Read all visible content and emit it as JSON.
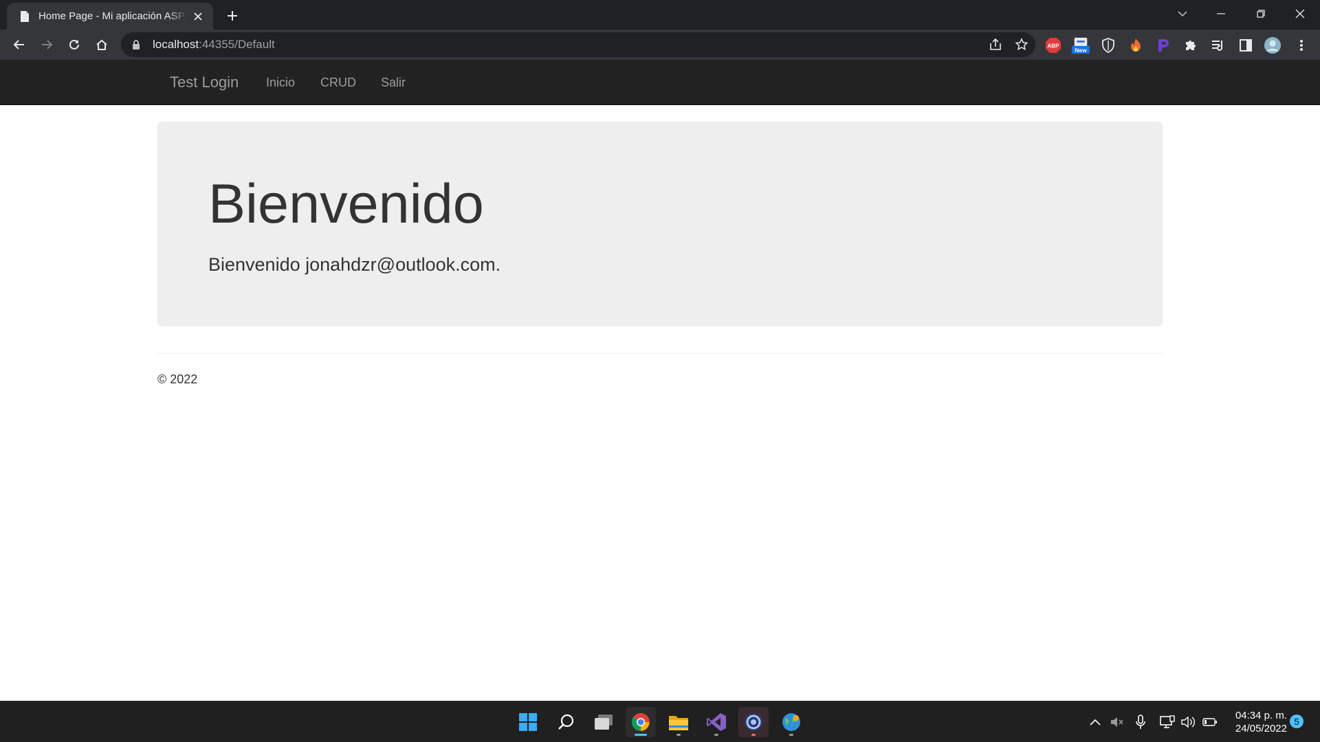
{
  "browser": {
    "tab_title": "Home Page - Mi aplicación ASP.NET",
    "url_host": "localhost",
    "url_rest": ":44355/Default",
    "extensions": [
      {
        "name": "adblock-plus-icon",
        "label": "ABP",
        "color": "#e5383b"
      },
      {
        "name": "new-extension-icon",
        "label": "New",
        "color": "#1a73e8"
      }
    ]
  },
  "site": {
    "brand": "Test Login",
    "nav": [
      "Inicio",
      "CRUD",
      "Salir"
    ]
  },
  "jumbotron": {
    "title": "Bienvenido",
    "message": "Bienvenido jonahdzr@outlook.com."
  },
  "footer": {
    "copyright": "© 2022"
  },
  "taskbar": {
    "time": "04:34 p. m.",
    "date": "24/05/2022",
    "notifications": "5"
  },
  "colors": {
    "navbar_bg": "#222222",
    "navbar_text": "#9d9d9d",
    "jumbotron_bg": "#eeeeee",
    "accent": "#4cc2ff"
  }
}
